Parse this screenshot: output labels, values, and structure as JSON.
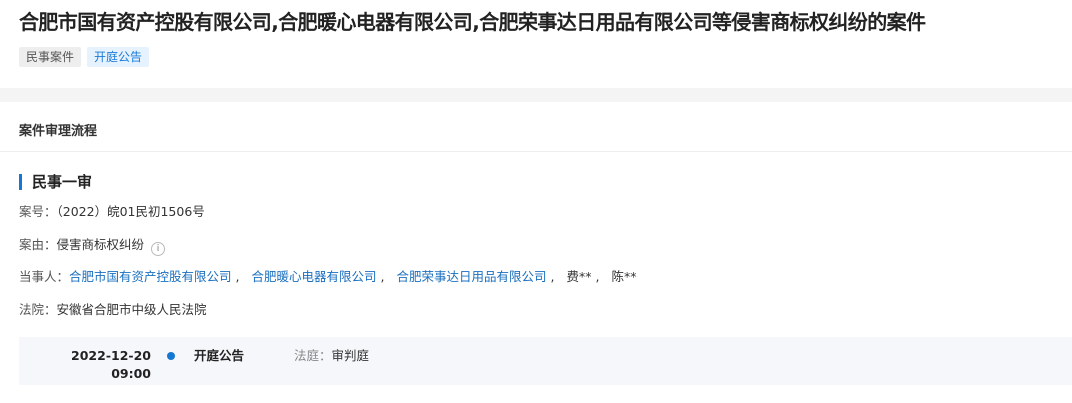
{
  "case": {
    "title": "合肥市国有资产控股有限公司,合肥暖心电器有限公司,合肥荣事达日用品有限公司等侵害商标权纠纷的案件",
    "tags": [
      "民事案件",
      "开庭公告"
    ]
  },
  "process": {
    "section_title": "案件审理流程",
    "stage_title": "民事一审",
    "case_no_label": "案号：",
    "case_no": "（2022）皖01民初1506号",
    "cause_label": "案由：",
    "cause": "侵害商标权纠纷",
    "parties_label": "当事人：",
    "parties": [
      "合肥市国有资产控股有限公司",
      "合肥暖心电器有限公司",
      "合肥荣事达日用品有限公司",
      "费**",
      "陈**"
    ],
    "court_label": "法院：",
    "court": "安徽省合肥市中级人民法院"
  },
  "timeline": {
    "date": "2022-12-20",
    "time": "09:00",
    "event": "开庭公告",
    "court_room_label": "法庭：",
    "court_room": "审判庭"
  },
  "icons": {
    "info": "info-circle-icon",
    "timeline_dot": "timeline-dot-icon"
  },
  "colors": {
    "accent": "#1677d2",
    "link": "#1a6fbf",
    "tag_blue_bg": "#e6f3fe"
  }
}
